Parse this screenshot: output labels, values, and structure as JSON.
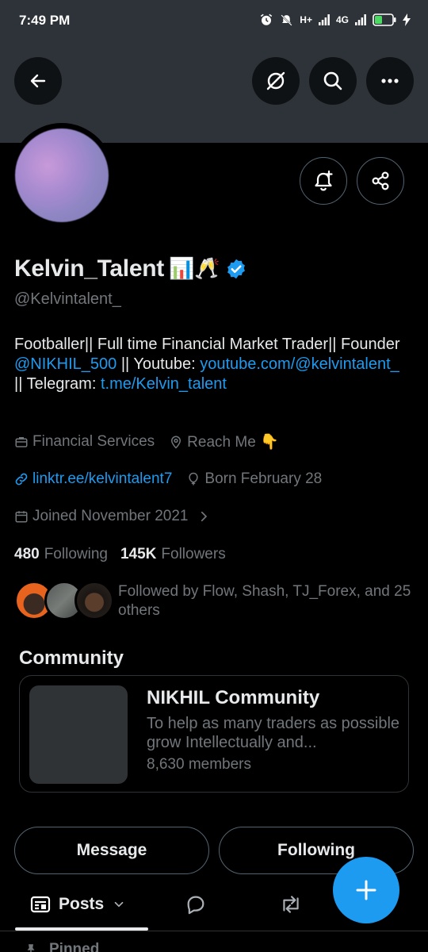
{
  "status_bar": {
    "time": "7:49 PM",
    "network_1": "H+",
    "network_2": "4G",
    "icons": [
      "alarm-icon",
      "mute-icon",
      "signal-icon",
      "signal-icon",
      "battery-icon",
      "charging-icon"
    ]
  },
  "header": {
    "back_icon": "arrow-left-icon",
    "grok_icon": "grok-icon",
    "search_icon": "search-icon",
    "more_icon": "more-horizontal-icon"
  },
  "profile": {
    "display_name": "Kelvin_Talent",
    "name_emojis": "📊🥂",
    "verified": true,
    "handle": "@Kelvintalent_",
    "bio": {
      "part1": "Footballer|| Full time Financial Market Trader|| Founder ",
      "mention": "@NIKHIL_500",
      "part2": " || Youtube: ",
      "youtube_link": "youtube.com/@kelvintalent_",
      "part3": " || Telegram: ",
      "telegram_link": "t.me/Kelvin_talent"
    },
    "category": "Financial Services",
    "location": "Reach Me 👇",
    "website": "linktr.ee/kelvintalent7",
    "birthday": "Born February 28",
    "joined": "Joined November 2021",
    "following_count": "480",
    "following_label": "Following",
    "followers_count": "145K",
    "followers_label": "Followers",
    "followed_by": "Followed by Flow, Shash, TJ_Forex, and 25 others"
  },
  "community": {
    "section_title": "Community",
    "name": "NIKHIL Community",
    "description": "To help as many traders as possible grow Intellectually and...",
    "members": "8,630 members"
  },
  "actions": {
    "message_label": "Message",
    "following_label": "Following"
  },
  "tabs": {
    "posts_label": "Posts",
    "active": "Posts"
  },
  "pinned_label": "Pinned",
  "colors": {
    "accent": "#1d9bf0",
    "background": "#000000",
    "banner": "#2d3338",
    "secondary_text": "#71767b",
    "primary_text": "#e7e9ea"
  }
}
